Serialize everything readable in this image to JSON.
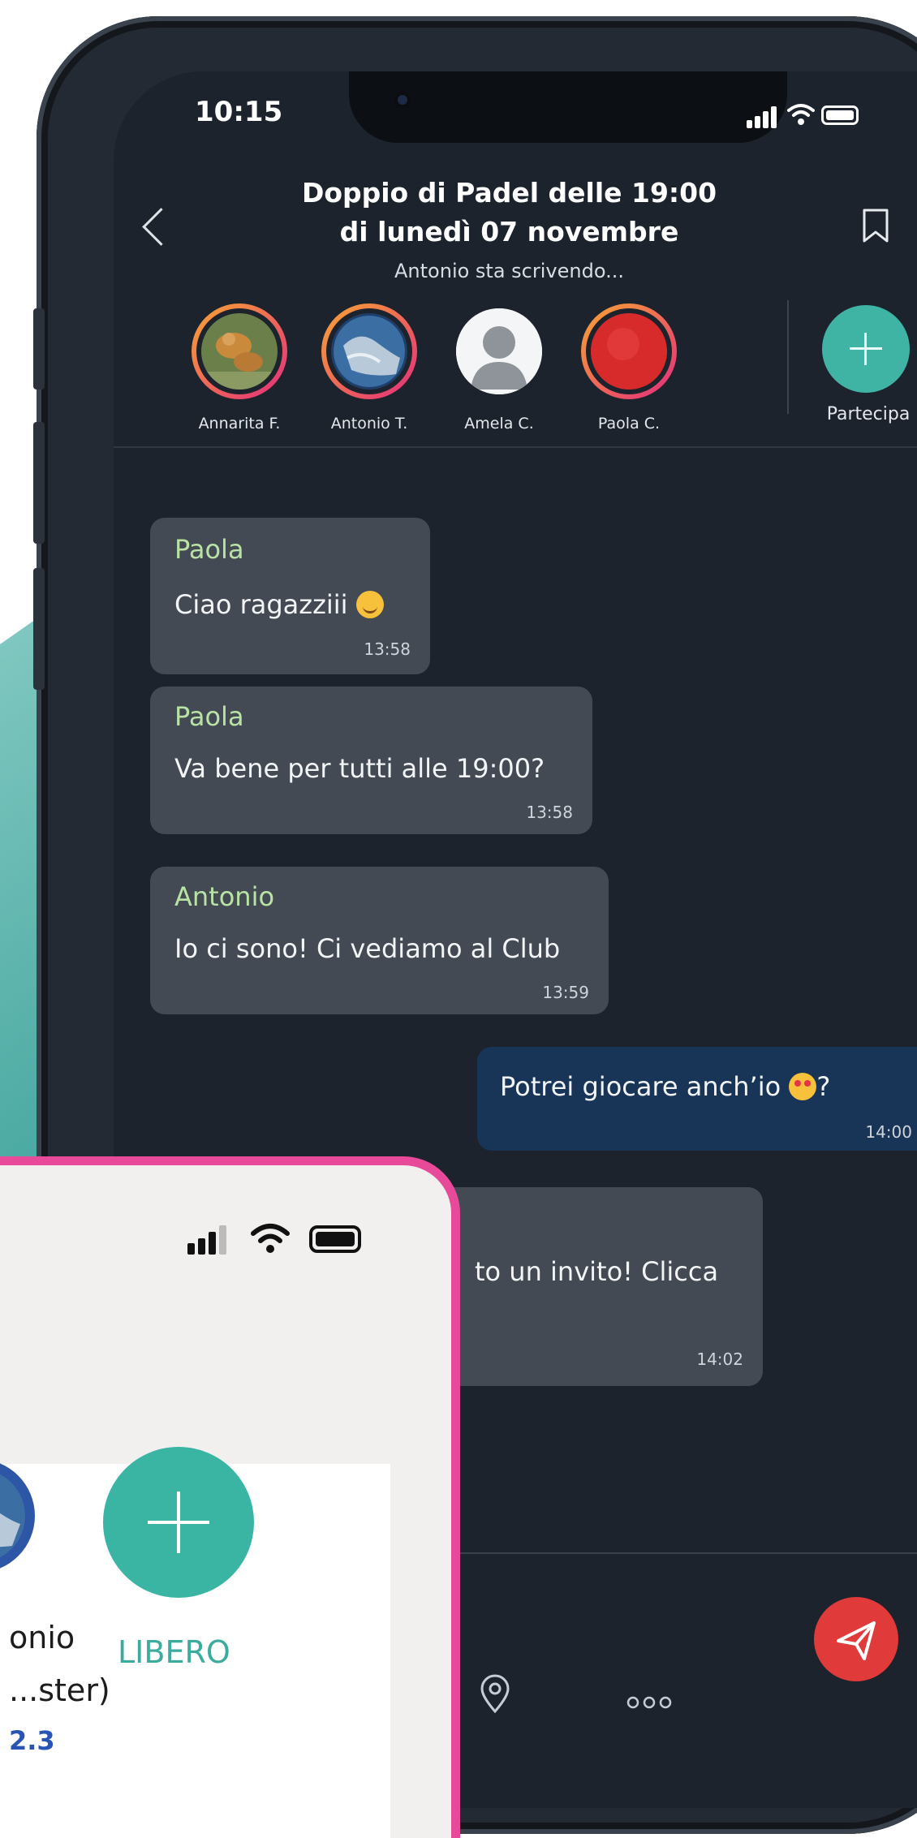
{
  "status_bar": {
    "time": "10:15"
  },
  "chat_header": {
    "title_line1": "Doppio di Padel delle 19:00",
    "title_line2": "di lunedì 07 novembre",
    "typing_status": "Antonio sta scrivendo..."
  },
  "participants": [
    {
      "name": "Annarita F."
    },
    {
      "name": "Antonio T."
    },
    {
      "name": "Amela C."
    },
    {
      "name": "Paola C."
    }
  ],
  "join": {
    "label": "Partecipa"
  },
  "messages": [
    {
      "sender": "Paola",
      "text": "Ciao ragazziii",
      "emoji": "smiling-blush-emoji",
      "time": "13:58",
      "outgoing": false
    },
    {
      "sender": "Paola",
      "text": "Va bene per tutti alle 19:00?",
      "time": "13:58",
      "outgoing": false
    },
    {
      "sender": "Antonio",
      "text": "Io ci sono! Ci vediamo al Club",
      "time": "13:59",
      "outgoing": false
    },
    {
      "text": "Potrei giocare anch’io",
      "emoji": "heart-eyes-emoji",
      "suffix": "?",
      "time": "14:00",
      "outgoing": true
    },
    {
      "text": "to un invito! Clicca",
      "time": "14:02",
      "outgoing": false
    }
  ],
  "overlay_card": {
    "player_name_fragment": "onio",
    "player_role_fragment": "...ster)",
    "player_level_fragment": "2.3",
    "free_slot_label": "LIBERO"
  },
  "colors": {
    "chat_background": "#1c232c",
    "incoming_bubble": "#434a54",
    "outgoing_bubble": "#183457",
    "sender_name": "#b8e3a4",
    "accent_teal": "#3fb3a4",
    "send_button": "#e03a3a",
    "card_border": "#e84a9a"
  },
  "icons": [
    "back-chevron-icon",
    "bookmark-icon",
    "plus-icon",
    "location-pin-icon",
    "more-dots-icon",
    "send-paper-plane-icon",
    "signal-icon",
    "wifi-icon",
    "battery-icon"
  ]
}
